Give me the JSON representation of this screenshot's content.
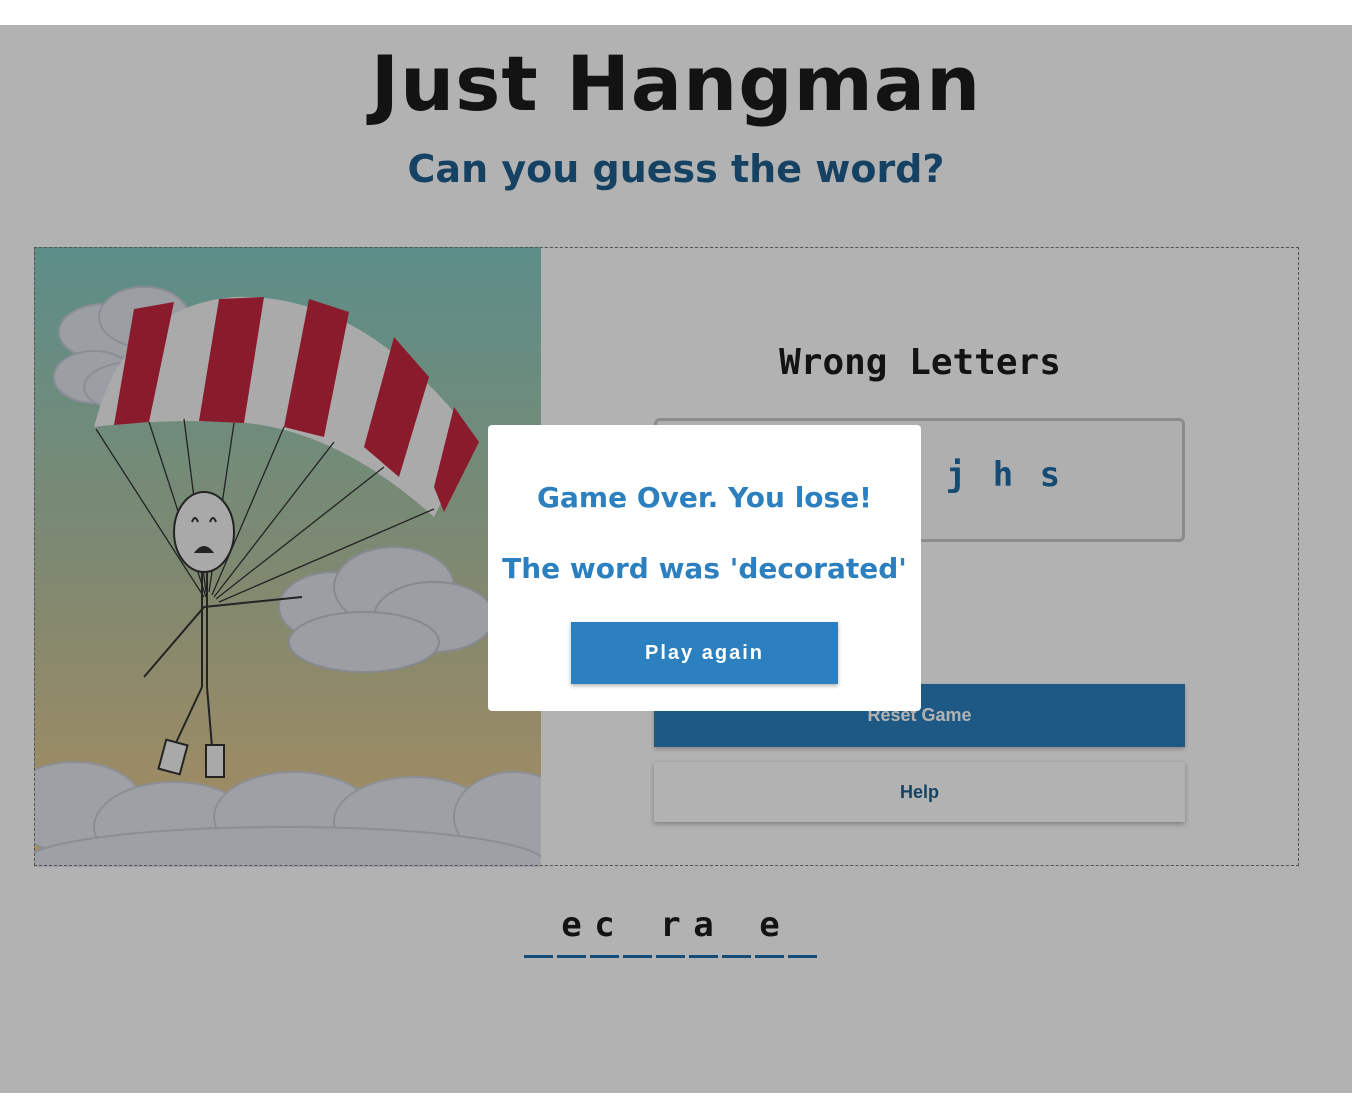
{
  "header": {
    "title": "Just Hangman",
    "subtitle": "Can you guess the word?"
  },
  "panel": {
    "wrong_letters_title": "Wrong Letters",
    "wrong_letters": "n j h s",
    "reset_label": "Reset Game",
    "help_label": "Help"
  },
  "word": {
    "slots": [
      "",
      "e",
      "c",
      "",
      "r",
      "a",
      "",
      "e",
      ""
    ]
  },
  "modal": {
    "message": "Game Over. You lose!",
    "reveal": "The word was 'decorated'",
    "play_again_label": "Play again"
  },
  "colors": {
    "accent": "#2c80bf",
    "title": "#1c1c1c",
    "subtitle": "#1f5f8e",
    "overlay": "#b2b2b2"
  }
}
